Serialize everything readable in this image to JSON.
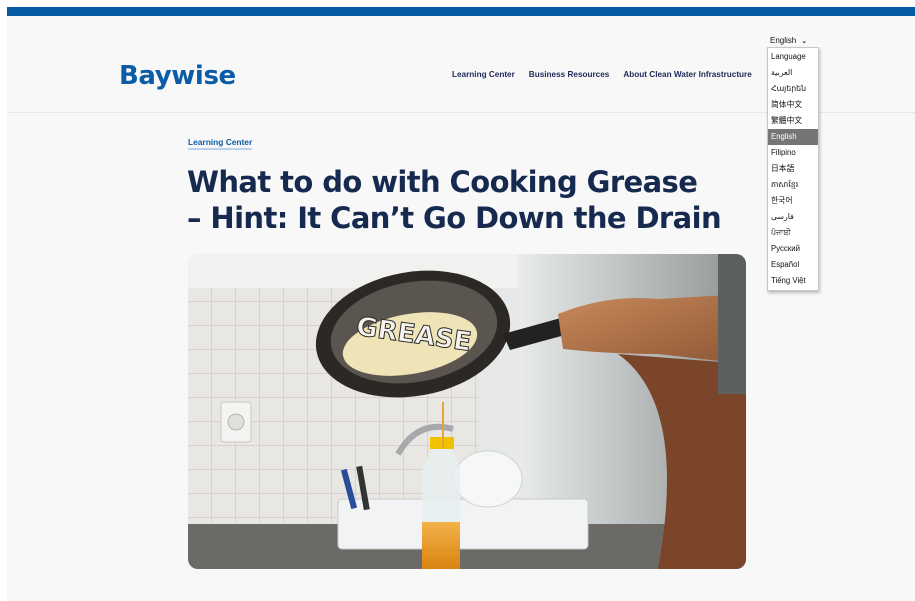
{
  "brand": {
    "logo": "Baywise",
    "color": "#0b5ca6"
  },
  "nav": {
    "items": [
      {
        "label": "Learning Center"
      },
      {
        "label": "Business Resources"
      },
      {
        "label": "About Clean Water Infrastructure"
      }
    ]
  },
  "language": {
    "selected": "English",
    "options": [
      "Language",
      "العربية",
      "Հայերեն",
      "简体中文",
      "繁體中文",
      "English",
      "Filipino",
      "日本語",
      "ភាសាខ្មែរ",
      "한국어",
      "فارسی",
      "ਪੰਜਾਬੀ",
      "Русский",
      "Español",
      "Tiếng Việt"
    ],
    "selected_index": 5
  },
  "article": {
    "breadcrumb": "Learning Center",
    "title_line1": "What to do with Cooking Grease",
    "title_line2": "– Hint: It Can’t Go Down the Drain",
    "hero_text": "GREASE"
  },
  "colors": {
    "top_bar": "#075aa6",
    "title": "#16294f",
    "nav": "#1d2a55"
  }
}
